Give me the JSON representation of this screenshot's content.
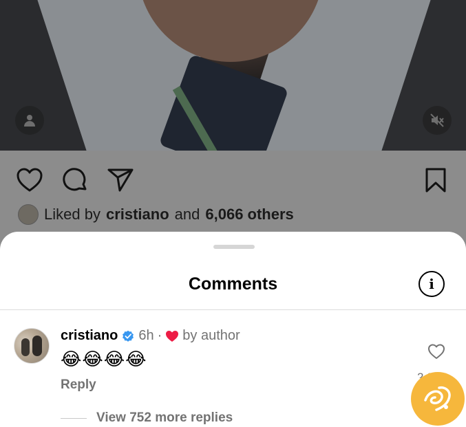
{
  "post": {
    "icons": [
      "user-tag-icon",
      "mute-icon",
      "heart-icon",
      "comment-icon",
      "send-icon",
      "bookmark-icon"
    ],
    "liked_prefix": "Liked by",
    "liked_user": "cristiano",
    "liked_and": "and",
    "liked_others": "6,066 others"
  },
  "sheet": {
    "title": "Comments",
    "info_glyph": "i"
  },
  "comment": {
    "username": "cristiano",
    "verified": true,
    "time": "6h",
    "separator": "·",
    "liked_by_label": "by author",
    "text": "😂😂😂😂",
    "reply_label": "Reply",
    "like_count": "2,069",
    "view_replies_label": "View 752 more replies"
  },
  "colors": {
    "verified_blue": "#3897f0",
    "heart_red": "#ed1c45",
    "muted_text": "#737373",
    "watermark": "#f6b73c"
  }
}
